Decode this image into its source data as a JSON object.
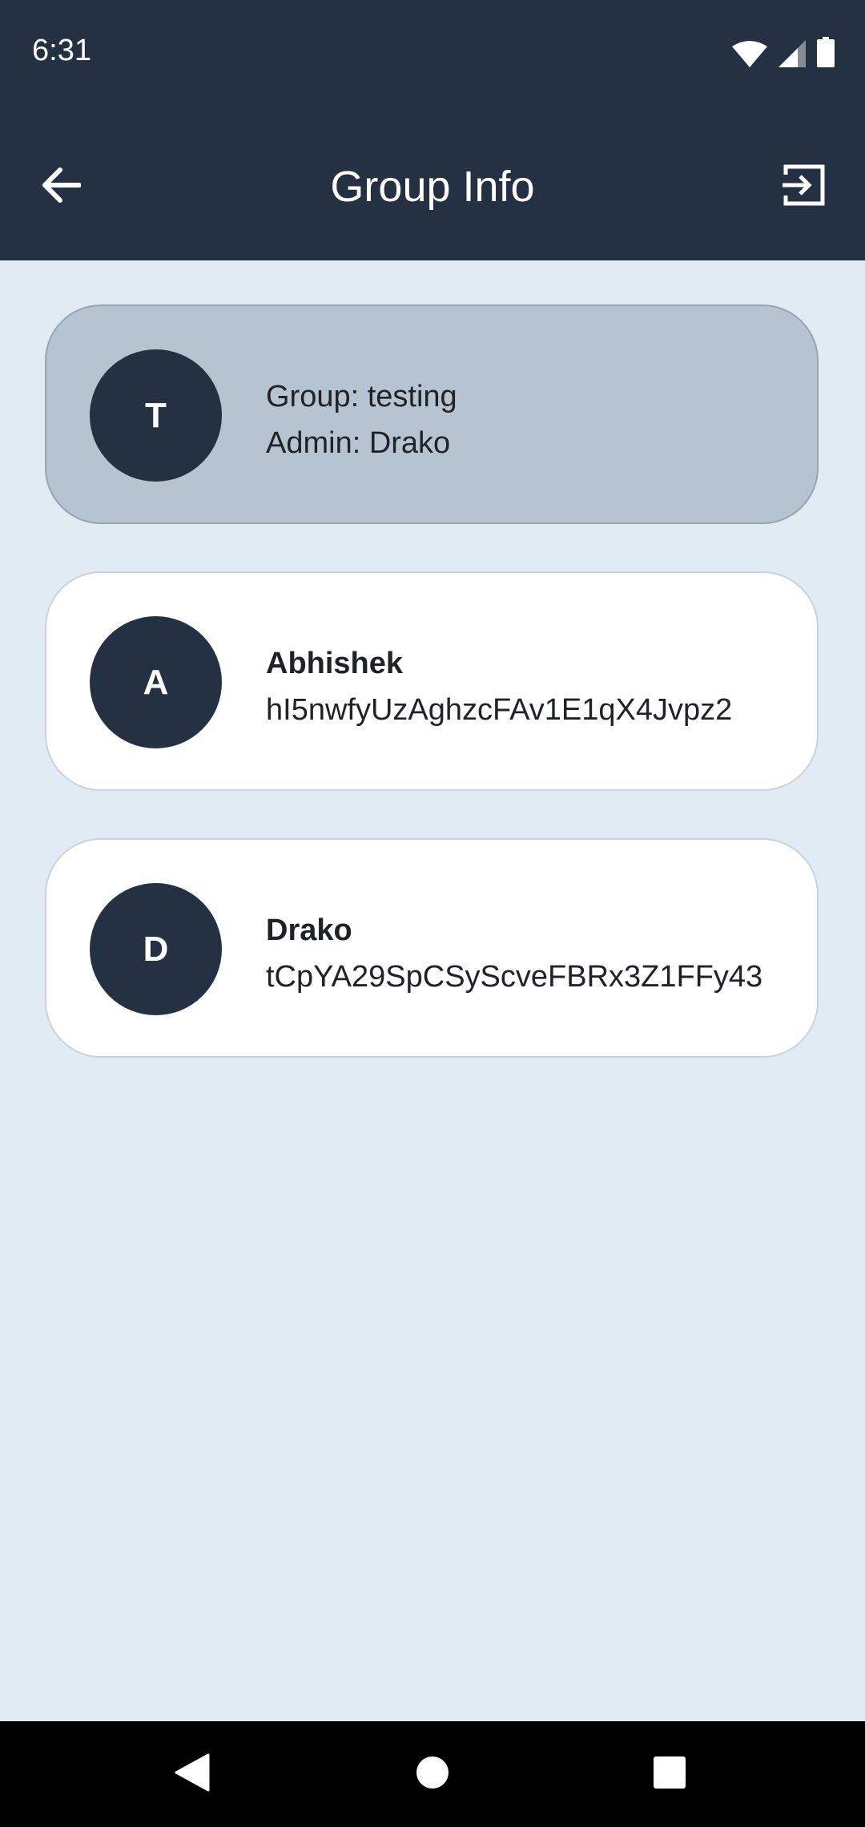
{
  "status_bar": {
    "time": "6:31",
    "icons": [
      "wifi-icon",
      "signal-icon",
      "battery-icon"
    ]
  },
  "header": {
    "title": "Group Info",
    "back_icon": "arrow-left-icon",
    "exit_icon": "exit-group-icon"
  },
  "group": {
    "avatar_letter": "T",
    "group_line": "Group: testing",
    "admin_line": "Admin: Drako"
  },
  "members": [
    {
      "avatar_letter": "A",
      "name": "Abhishek",
      "id": "hI5nwfyUzAghzcFAv1E1qX4Jvpz2"
    },
    {
      "avatar_letter": "D",
      "name": "Drako",
      "id": "tCpYA29SpCSyScveFBRx3Z1FFy43"
    }
  ],
  "nav_bar": {
    "icons": [
      "back-triangle-icon",
      "home-circle-icon",
      "recents-square-icon"
    ]
  },
  "colors": {
    "primary": "#233142",
    "background": "#e1ebf4",
    "group_card": "#b6c3d1",
    "member_card": "#ffffff"
  }
}
